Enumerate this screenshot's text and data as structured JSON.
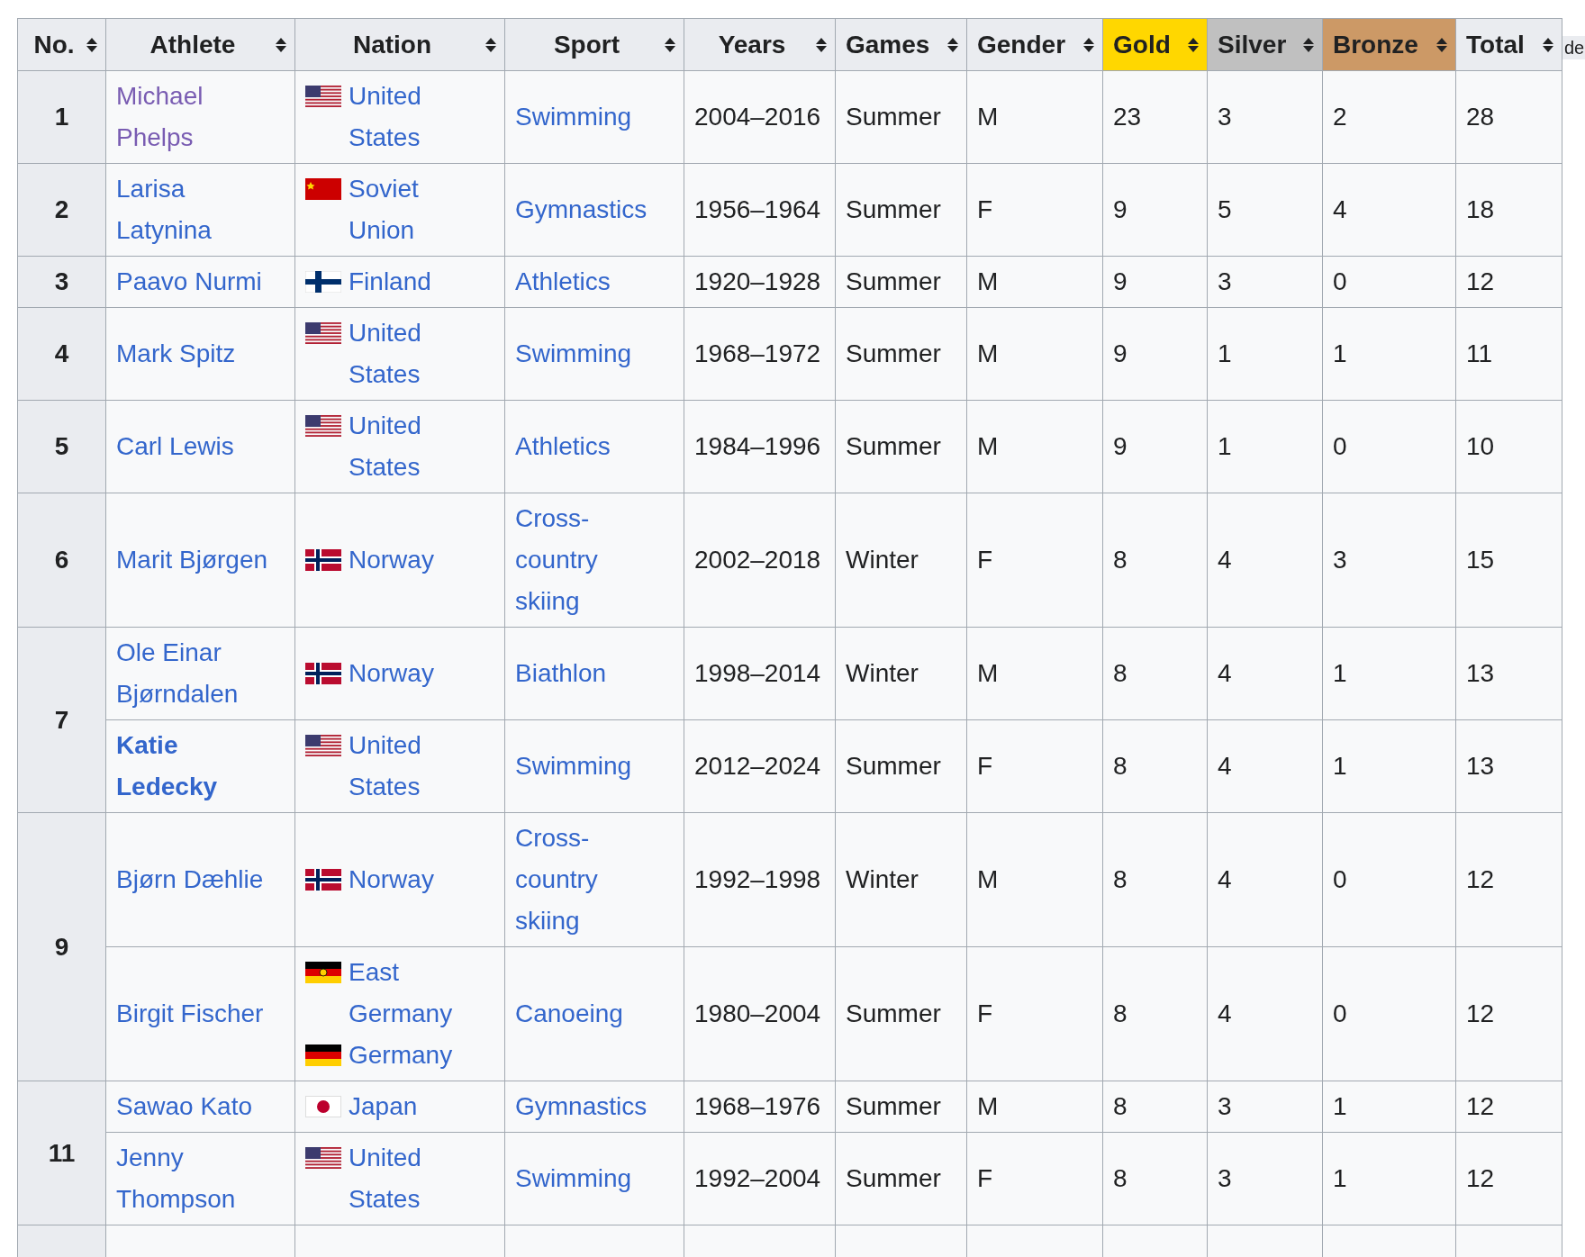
{
  "table": {
    "columns": [
      {
        "label": "No.",
        "color": "#eaecf0"
      },
      {
        "label": "Athlete",
        "color": "#eaecf0"
      },
      {
        "label": "Nation",
        "color": "#eaecf0"
      },
      {
        "label": "Sport",
        "color": "#eaecf0"
      },
      {
        "label": "Years",
        "color": "#eaecf0"
      },
      {
        "label": "Games",
        "color": "#eaecf0"
      },
      {
        "label": "Gender",
        "color": "#eaecf0"
      },
      {
        "label": "Gold",
        "color": "#ffd700"
      },
      {
        "label": "Silver",
        "color": "#c0c0c0"
      },
      {
        "label": "Bronze",
        "color": "#cc9966"
      },
      {
        "label": "Total",
        "color": "#eaecf0"
      }
    ],
    "groups": [
      {
        "rank": "1",
        "entries": [
          {
            "athlete": {
              "name": "Michael Phelps",
              "visited": true,
              "current": false
            },
            "nations": [
              {
                "kind": "usa",
                "name": "United States"
              }
            ],
            "sport": "Swimming",
            "years": "2004–2016",
            "games": "Summer",
            "gender": "M",
            "gold": "23",
            "silver": "3",
            "bronze": "2",
            "total": "28"
          }
        ]
      },
      {
        "rank": "2",
        "entries": [
          {
            "athlete": {
              "name": "Larisa Latynina",
              "visited": false,
              "current": false
            },
            "nations": [
              {
                "kind": "ussr",
                "name": "Soviet Union"
              }
            ],
            "sport": "Gymnastics",
            "years": "1956–1964",
            "games": "Summer",
            "gender": "F",
            "gold": "9",
            "silver": "5",
            "bronze": "4",
            "total": "18"
          }
        ]
      },
      {
        "rank": "3",
        "entries": [
          {
            "athlete": {
              "name": "Paavo Nurmi",
              "visited": false,
              "current": false
            },
            "nations": [
              {
                "kind": "finland",
                "name": "Finland"
              }
            ],
            "sport": "Athletics",
            "years": "1920–1928",
            "games": "Summer",
            "gender": "M",
            "gold": "9",
            "silver": "3",
            "bronze": "0",
            "total": "12"
          }
        ]
      },
      {
        "rank": "4",
        "entries": [
          {
            "athlete": {
              "name": "Mark Spitz",
              "visited": false,
              "current": false
            },
            "nations": [
              {
                "kind": "usa",
                "name": "United States"
              }
            ],
            "sport": "Swimming",
            "years": "1968–1972",
            "games": "Summer",
            "gender": "M",
            "gold": "9",
            "silver": "1",
            "bronze": "1",
            "total": "11"
          }
        ]
      },
      {
        "rank": "5",
        "entries": [
          {
            "athlete": {
              "name": "Carl Lewis",
              "visited": false,
              "current": false
            },
            "nations": [
              {
                "kind": "usa",
                "name": "United States"
              }
            ],
            "sport": "Athletics",
            "years": "1984–1996",
            "games": "Summer",
            "gender": "M",
            "gold": "9",
            "silver": "1",
            "bronze": "0",
            "total": "10"
          }
        ]
      },
      {
        "rank": "6",
        "entries": [
          {
            "athlete": {
              "name": "Marit Bjørgen",
              "visited": false,
              "current": false
            },
            "nations": [
              {
                "kind": "norway",
                "name": "Norway"
              }
            ],
            "sport": "Cross-country skiing",
            "years": "2002–2018",
            "games": "Winter",
            "gender": "F",
            "gold": "8",
            "silver": "4",
            "bronze": "3",
            "total": "15"
          }
        ]
      },
      {
        "rank": "7",
        "entries": [
          {
            "athlete": {
              "name": "Ole Einar Bjørndalen",
              "visited": false,
              "current": false
            },
            "nations": [
              {
                "kind": "norway",
                "name": "Norway"
              }
            ],
            "sport": "Biathlon",
            "years": "1998–2014",
            "games": "Winter",
            "gender": "M",
            "gold": "8",
            "silver": "4",
            "bronze": "1",
            "total": "13"
          },
          {
            "athlete": {
              "name": "Katie Ledecky",
              "visited": false,
              "current": true
            },
            "nations": [
              {
                "kind": "usa",
                "name": "United States"
              }
            ],
            "sport": "Swimming",
            "years": "2012–2024",
            "games": "Summer",
            "gender": "F",
            "gold": "8",
            "silver": "4",
            "bronze": "1",
            "total": "13"
          }
        ]
      },
      {
        "rank": "9",
        "entries": [
          {
            "athlete": {
              "name": "Bjørn Dæhlie",
              "visited": false,
              "current": false
            },
            "nations": [
              {
                "kind": "norway",
                "name": "Norway"
              }
            ],
            "sport": "Cross-country skiing",
            "years": "1992–1998",
            "games": "Winter",
            "gender": "M",
            "gold": "8",
            "silver": "4",
            "bronze": "0",
            "total": "12"
          },
          {
            "athlete": {
              "name": "Birgit Fischer",
              "visited": false,
              "current": false
            },
            "nations": [
              {
                "kind": "gdr",
                "name": "East Germany"
              },
              {
                "kind": "germany",
                "name": "Germany"
              }
            ],
            "sport": "Canoeing",
            "years": "1980–2004",
            "games": "Summer",
            "gender": "F",
            "gold": "8",
            "silver": "4",
            "bronze": "0",
            "total": "12"
          }
        ]
      },
      {
        "rank": "11",
        "entries": [
          {
            "athlete": {
              "name": "Sawao Kato",
              "visited": false,
              "current": false
            },
            "nations": [
              {
                "kind": "japan",
                "name": "Japan"
              }
            ],
            "sport": "Gymnastics",
            "years": "1968–1976",
            "games": "Summer",
            "gender": "M",
            "gold": "8",
            "silver": "3",
            "bronze": "1",
            "total": "12"
          },
          {
            "athlete": {
              "name": "Jenny Thompson",
              "visited": false,
              "current": false
            },
            "nations": [
              {
                "kind": "usa",
                "name": "United States"
              }
            ],
            "sport": "Swimming",
            "years": "1992–2004",
            "games": "Summer",
            "gender": "F",
            "gold": "8",
            "silver": "3",
            "bronze": "1",
            "total": "12"
          }
        ]
      }
    ]
  },
  "side_fragment": "de"
}
